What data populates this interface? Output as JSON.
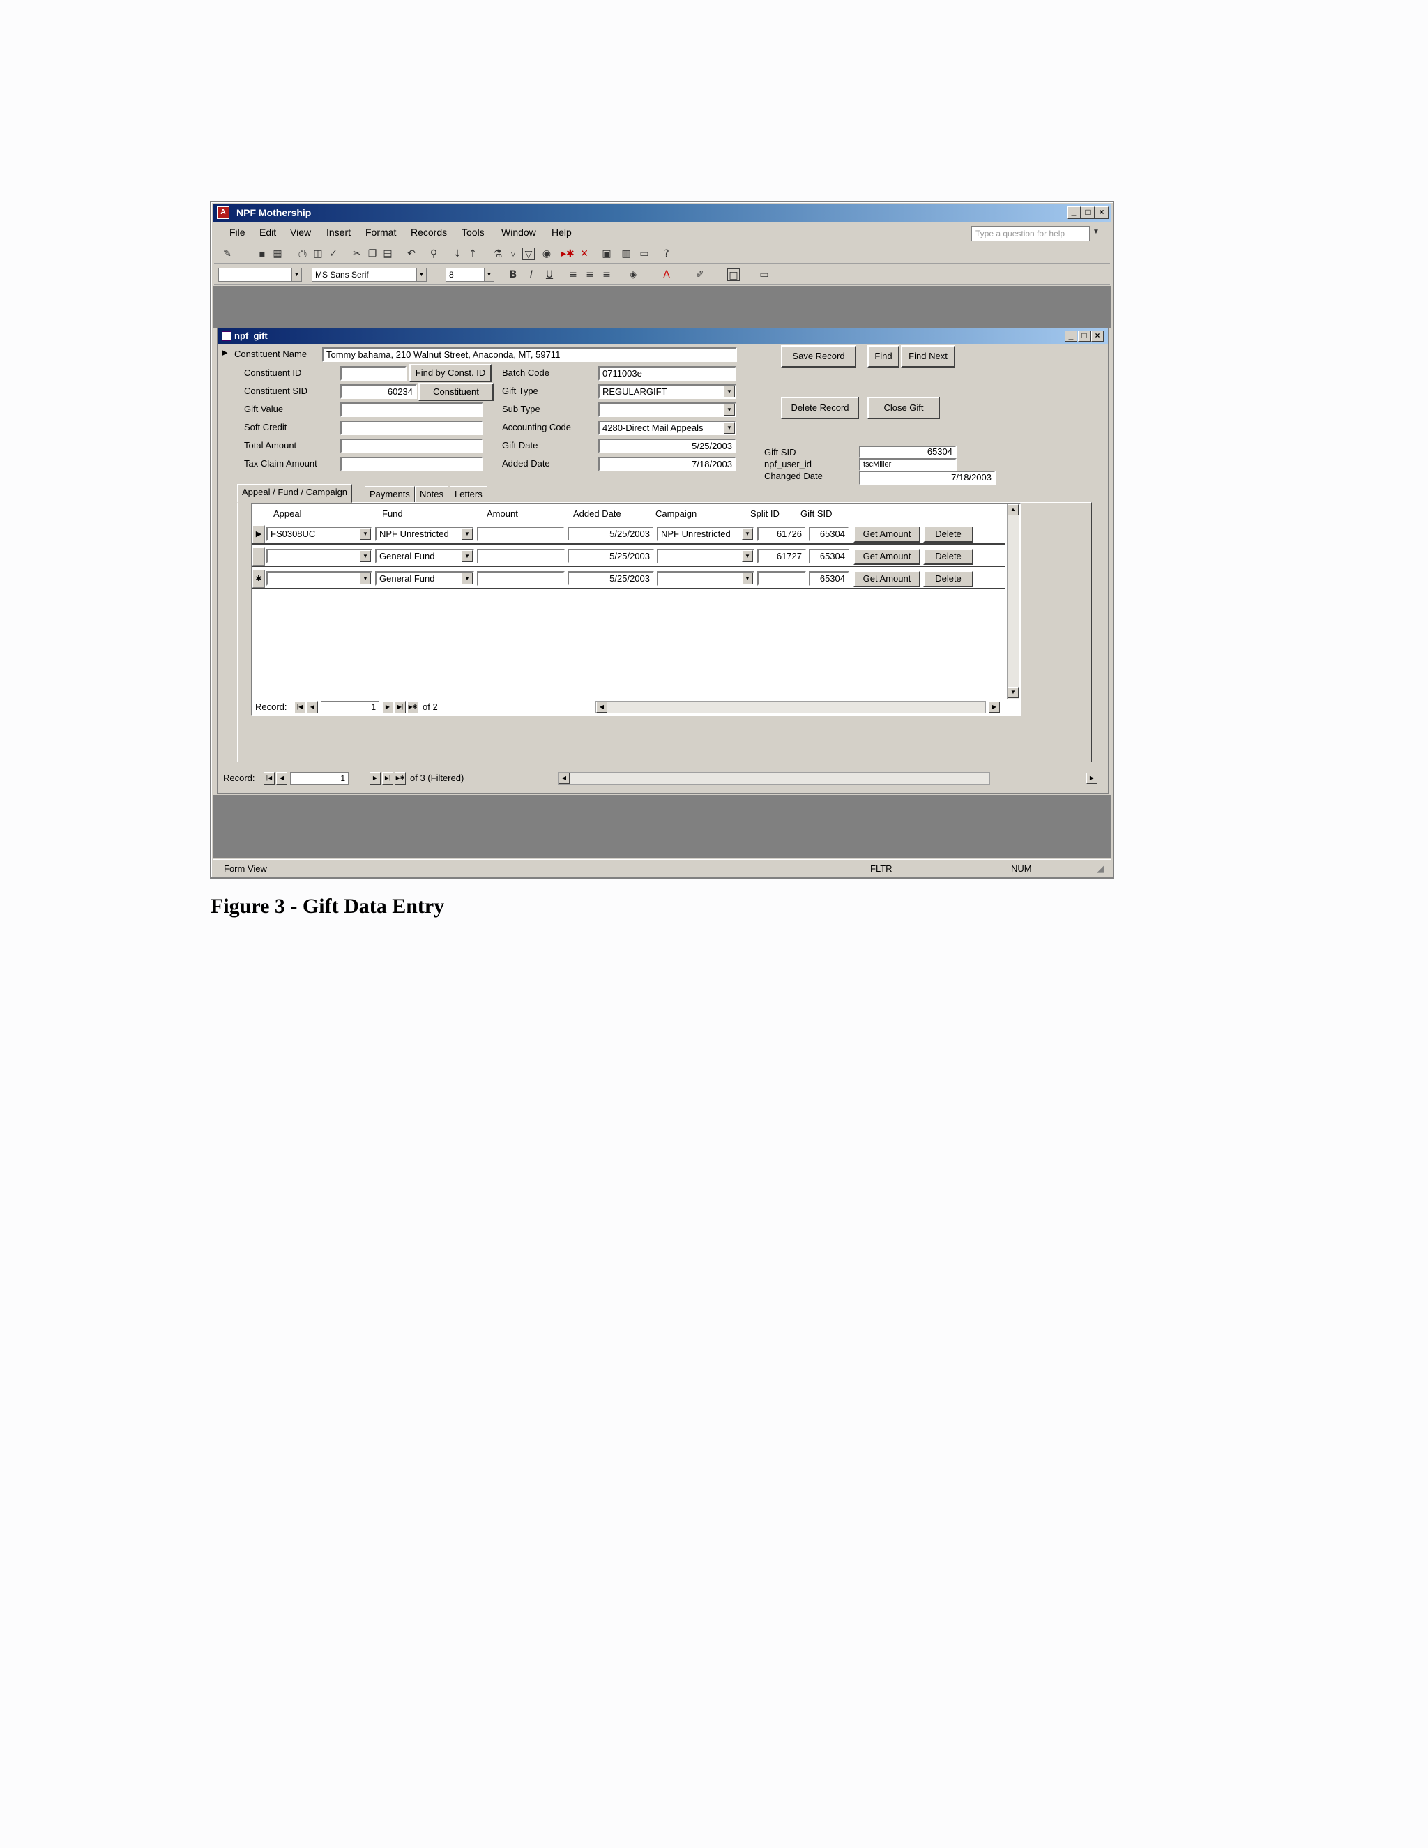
{
  "app": {
    "title": "NPF Mothership",
    "icon_name": "access-app-icon",
    "menu": [
      "File",
      "Edit",
      "View",
      "Insert",
      "Format",
      "Records",
      "Tools",
      "Window",
      "Help"
    ],
    "help_placeholder": "Type a question for help",
    "font_name": "MS Sans Serif",
    "font_size": "8",
    "toolbar_icons": [
      "design-view-icon",
      "save-icon",
      "print-icon",
      "print-preview-icon",
      "spell-icon",
      "cut-icon",
      "copy-icon",
      "paste-icon",
      "undo-icon",
      "sort-ascending-icon",
      "sort-descending-icon",
      "filter-icon",
      "apply-filter-icon",
      "find-icon",
      "new-record-icon",
      "delete-record-icon",
      "properties-icon",
      "database-window-icon",
      "new-object-icon",
      "help-icon"
    ],
    "format_icons": [
      "bold-icon",
      "italic-icon",
      "underline-icon",
      "align-left-icon",
      "align-center-icon",
      "align-right-icon",
      "fill-color-icon",
      "font-color-icon",
      "line-color-icon",
      "border-icon",
      "special-effect-icon"
    ]
  },
  "form": {
    "title": "npf_gift",
    "constituent_name_label": "Constituent Name",
    "constituent_name": "Tommy bahama, 210 Walnut Street, Anaconda, MT, 59711",
    "left_fields": [
      {
        "label": "Constituent ID",
        "value": ""
      },
      {
        "label": "Constituent SID",
        "value": "60234"
      },
      {
        "label": "Gift Value",
        "value": ""
      },
      {
        "label": "Soft Credit",
        "value": ""
      },
      {
        "label": "Total Amount",
        "value": ""
      },
      {
        "label": "Tax Claim Amount",
        "value": ""
      }
    ],
    "find_by_const_button": "Find by Const. ID",
    "constituent_button": "Constituent",
    "mid_fields": [
      {
        "label": "Batch Code",
        "value": "0711003e"
      },
      {
        "label": "Gift Type",
        "value": "REGULARGIFT"
      },
      {
        "label": "Sub Type",
        "value": ""
      },
      {
        "label": "Accounting Code",
        "value": "4280-Direct Mail Appeals"
      },
      {
        "label": "Gift Date",
        "value": "5/25/2003"
      },
      {
        "label": "Added Date",
        "value": "7/18/2003"
      }
    ],
    "buttons": {
      "save_record": "Save Record",
      "find": "Find",
      "find_next": "Find Next",
      "delete_record": "Delete Record",
      "close_gift": "Close Gift"
    },
    "right_fields": [
      {
        "label": "Gift SID",
        "value": "65304"
      },
      {
        "label": "npf_user_id",
        "value": "tscMiller"
      },
      {
        "label": "Changed Date",
        "value": "7/18/2003"
      }
    ],
    "tabs": [
      "Appeal / Fund / Campaign",
      "Payments",
      "Notes",
      "Letters"
    ],
    "grid": {
      "headers": [
        "Appeal",
        "Fund",
        "Amount",
        "Added Date",
        "Campaign",
        "Split ID",
        "Gift SID"
      ],
      "rows": [
        {
          "selector": "▶",
          "appeal": "FS0308UC",
          "fund": "NPF Unrestricted",
          "amount": "",
          "added_date": "5/25/2003",
          "campaign": "NPF Unrestricted",
          "split_id": "61726",
          "gift_sid": "65304",
          "get_amount": "Get Amount",
          "delete": "Delete"
        },
        {
          "selector": "",
          "appeal": "",
          "fund": "General Fund",
          "amount": "",
          "added_date": "5/25/2003",
          "campaign": "",
          "split_id": "61727",
          "gift_sid": "65304",
          "get_amount": "Get Amount",
          "delete": "Delete"
        },
        {
          "selector": "✱",
          "appeal": "",
          "fund": "General Fund",
          "amount": "",
          "added_date": "5/25/2003",
          "campaign": "",
          "split_id": "",
          "gift_sid": "65304",
          "get_amount": "Get Amount",
          "delete": "Delete"
        }
      ]
    },
    "sub_nav": {
      "label": "Record:",
      "current": "1",
      "of_text": "of  2"
    },
    "main_nav": {
      "label": "Record:",
      "current": "1",
      "of_text": "of  3 (Filtered)"
    }
  },
  "status_bar": {
    "mode": "Form View",
    "fltr": "FLTR",
    "num": "NUM"
  },
  "caption": "Figure 3 - Gift Data Entry"
}
